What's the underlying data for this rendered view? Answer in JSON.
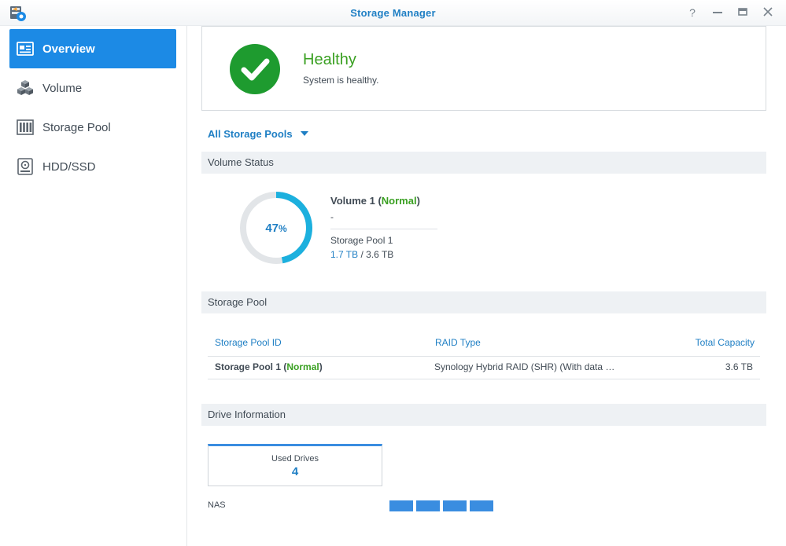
{
  "window": {
    "title": "Storage Manager",
    "controls": {
      "help": "?",
      "minimize": "—",
      "maximize": "▭",
      "close": "✕"
    }
  },
  "sidebar": {
    "items": [
      {
        "label": "Overview",
        "icon": "overview-icon",
        "active": true
      },
      {
        "label": "Volume",
        "icon": "volume-cubes-icon",
        "active": false
      },
      {
        "label": "Storage Pool",
        "icon": "storage-pool-icon",
        "active": false
      },
      {
        "label": "HDD/SSD",
        "icon": "hdd-icon",
        "active": false
      }
    ]
  },
  "health": {
    "status": "Healthy",
    "message": "System is healthy.",
    "icon": "check-circle-icon",
    "color": "#1e9b2f"
  },
  "filter": {
    "selected": "All Storage Pools"
  },
  "volume_status": {
    "heading": "Volume Status",
    "usage_percent": 47,
    "usage_number": "47",
    "usage_unit": "%",
    "volume_name": "Volume 1",
    "volume_state": "Normal",
    "description": "-",
    "pool": "Storage Pool 1",
    "used": "1.7 TB",
    "separator": "/",
    "total": "3.6 TB"
  },
  "storage_pool": {
    "heading": "Storage Pool",
    "columns": [
      "Storage Pool ID",
      "RAID Type",
      "Total Capacity"
    ],
    "rows": [
      {
        "id": "Storage Pool 1",
        "state": "Normal",
        "raid": "Synology Hybrid RAID (SHR) (With data …",
        "capacity": "3.6 TB"
      }
    ]
  },
  "drive_info": {
    "heading": "Drive Information",
    "used_drives_label": "Used Drives",
    "used_drives": "4",
    "nas_label": "NAS",
    "slots": 4,
    "slot_color": "#3a8de0"
  },
  "colors": {
    "accent": "#1c8ae5",
    "link": "#1f7fc4",
    "ok": "#3aa022"
  }
}
